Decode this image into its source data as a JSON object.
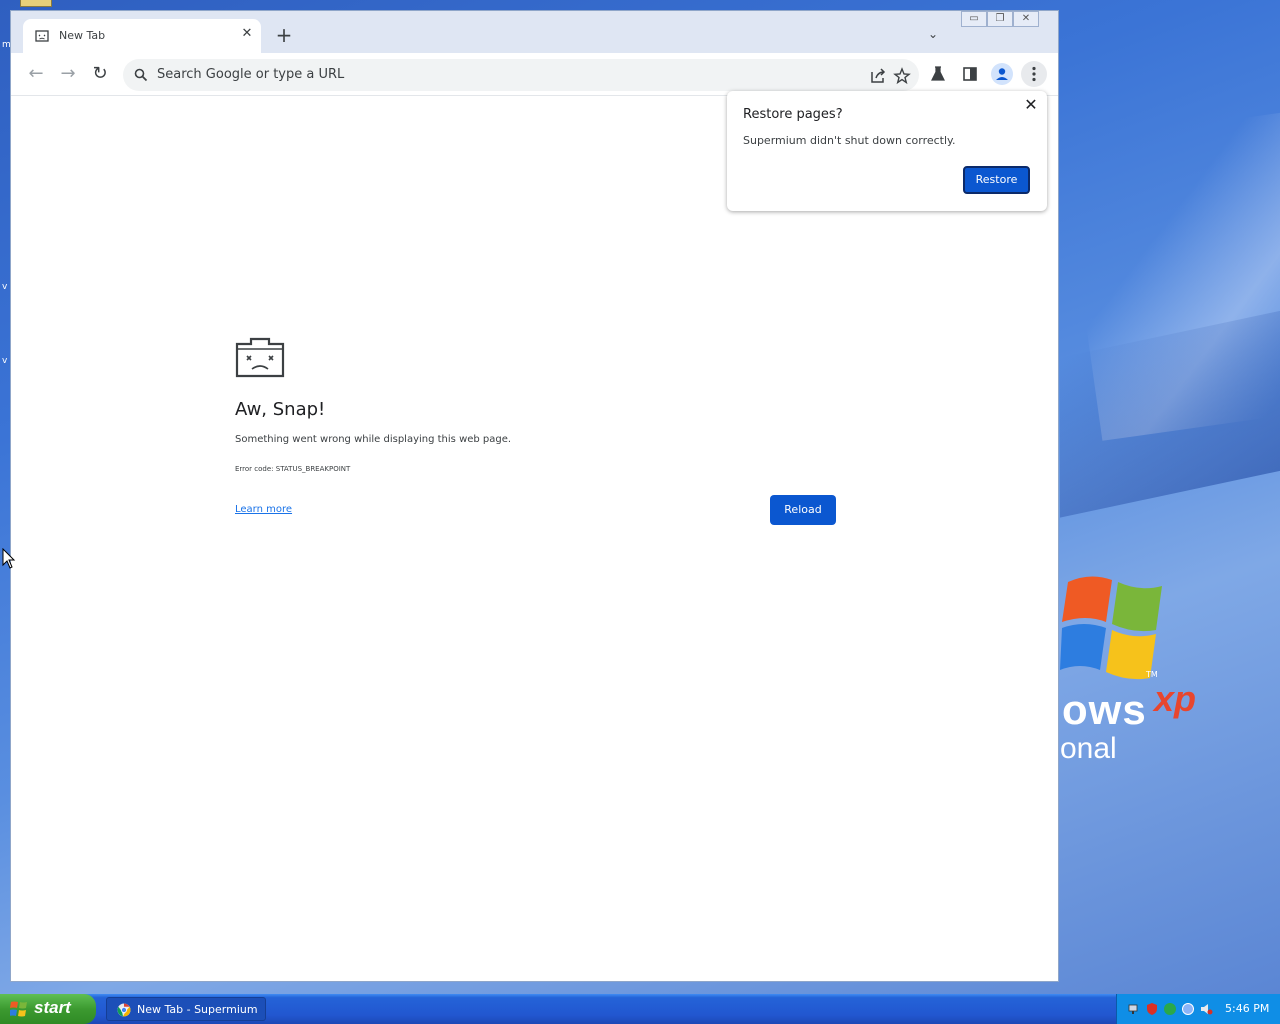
{
  "desktop": {
    "xp_word": "ows",
    "xp_super": "xp",
    "xp_sub": "onal",
    "xp_tm": "TM",
    "side_letters": [
      "m",
      "v",
      "v"
    ]
  },
  "browser": {
    "tab": {
      "title": "New Tab",
      "close_glyph": "✕"
    },
    "newtab_glyph": "+",
    "tabsearch_glyph": "⌄",
    "window_controls": [
      "▭",
      "❐",
      "✕"
    ],
    "nav": {
      "back": "←",
      "forward": "→",
      "reload": "↻"
    },
    "omnibox": {
      "placeholder": "Search Google or type a URL"
    }
  },
  "restore_bubble": {
    "title": "Restore pages?",
    "message": "Supermium didn't shut down correctly.",
    "button": "Restore",
    "close_glyph": "✕"
  },
  "sad_tab": {
    "title": "Aw, Snap!",
    "message": "Something went wrong while displaying this web page.",
    "error_code": "Error code: STATUS_BREAKPOINT",
    "learn_more": "Learn more",
    "reload": "Reload"
  },
  "taskbar": {
    "start_label": "start",
    "task": "New Tab - Supermium",
    "clock": "5:46 PM"
  },
  "colors": {
    "accent_blue": "#0b57d0",
    "link_blue": "#1a73e8",
    "taskbar_blue": "#2257d0",
    "start_green": "#3c9a30"
  }
}
